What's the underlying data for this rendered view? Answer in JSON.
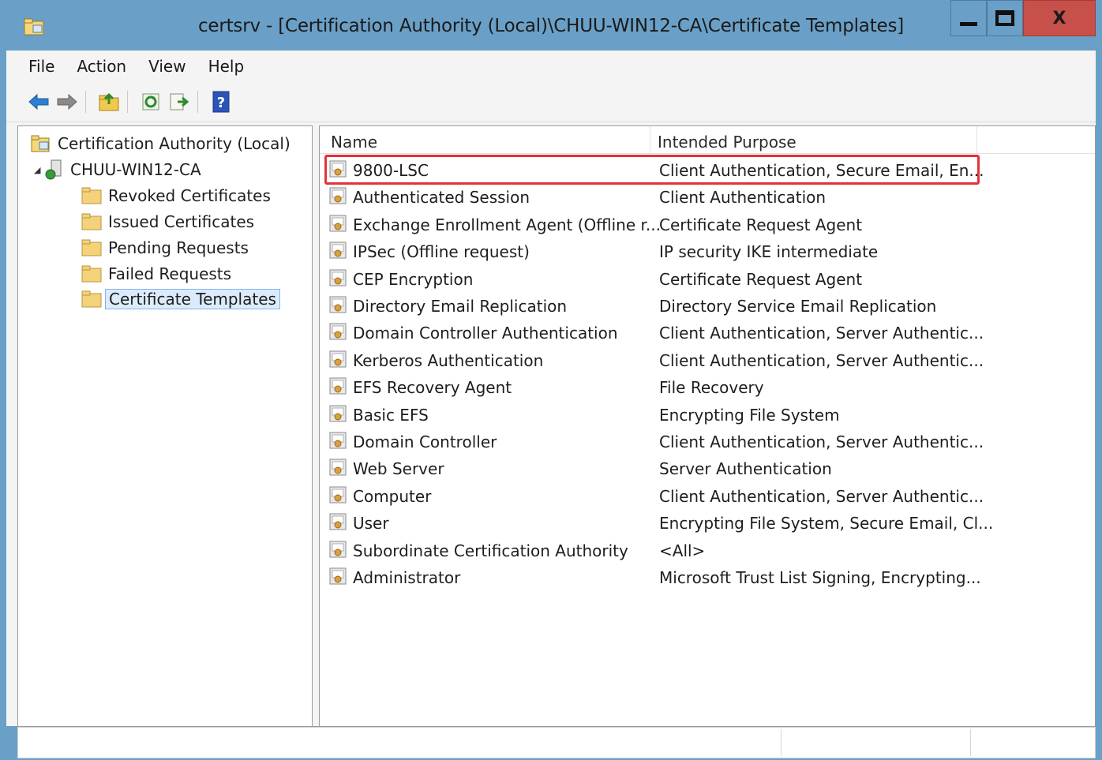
{
  "window": {
    "title": "certsrv - [Certification Authority (Local)\\CHUU-WIN12-CA\\Certificate Templates]",
    "close_label": "X"
  },
  "menu": [
    "File",
    "Action",
    "View",
    "Help"
  ],
  "toolbar": {
    "icons": [
      "back-arrow-icon",
      "forward-arrow-icon",
      "up-folder-icon",
      "refresh-icon",
      "export-list-icon",
      "help-icon"
    ]
  },
  "tree": {
    "root": "Certification Authority (Local)",
    "ca": "CHUU-WIN12-CA",
    "folders": [
      "Revoked Certificates",
      "Issued Certificates",
      "Pending Requests",
      "Failed Requests",
      "Certificate Templates"
    ],
    "selected": "Certificate Templates"
  },
  "list": {
    "columns": [
      "Name",
      "Intended Purpose"
    ],
    "rows": [
      {
        "name": "9800-LSC",
        "purpose": "Client Authentication, Secure Email, En..."
      },
      {
        "name": "Authenticated Session",
        "purpose": "Client Authentication"
      },
      {
        "name": "Exchange Enrollment Agent (Offline r...",
        "purpose": "Certificate Request Agent"
      },
      {
        "name": "IPSec (Offline request)",
        "purpose": "IP security IKE intermediate"
      },
      {
        "name": "CEP Encryption",
        "purpose": "Certificate Request Agent"
      },
      {
        "name": "Directory Email Replication",
        "purpose": "Directory Service Email Replication"
      },
      {
        "name": "Domain Controller Authentication",
        "purpose": "Client Authentication, Server Authentic..."
      },
      {
        "name": "Kerberos Authentication",
        "purpose": "Client Authentication, Server Authentic..."
      },
      {
        "name": "EFS Recovery Agent",
        "purpose": "File Recovery"
      },
      {
        "name": "Basic EFS",
        "purpose": "Encrypting File System"
      },
      {
        "name": "Domain Controller",
        "purpose": "Client Authentication, Server Authentic..."
      },
      {
        "name": "Web Server",
        "purpose": "Server Authentication"
      },
      {
        "name": "Computer",
        "purpose": "Client Authentication, Server Authentic..."
      },
      {
        "name": "User",
        "purpose": "Encrypting File System, Secure Email, Cl..."
      },
      {
        "name": "Subordinate Certification Authority",
        "purpose": "<All>"
      },
      {
        "name": "Administrator",
        "purpose": "Microsoft Trust List Signing, Encrypting..."
      }
    ],
    "highlighted_row": "9800-LSC",
    "highlight_color": "#e0343a"
  },
  "colors": {
    "titlebar": "#6aa0c7",
    "close_button": "#c7504a",
    "selection": "#dcebfb"
  }
}
